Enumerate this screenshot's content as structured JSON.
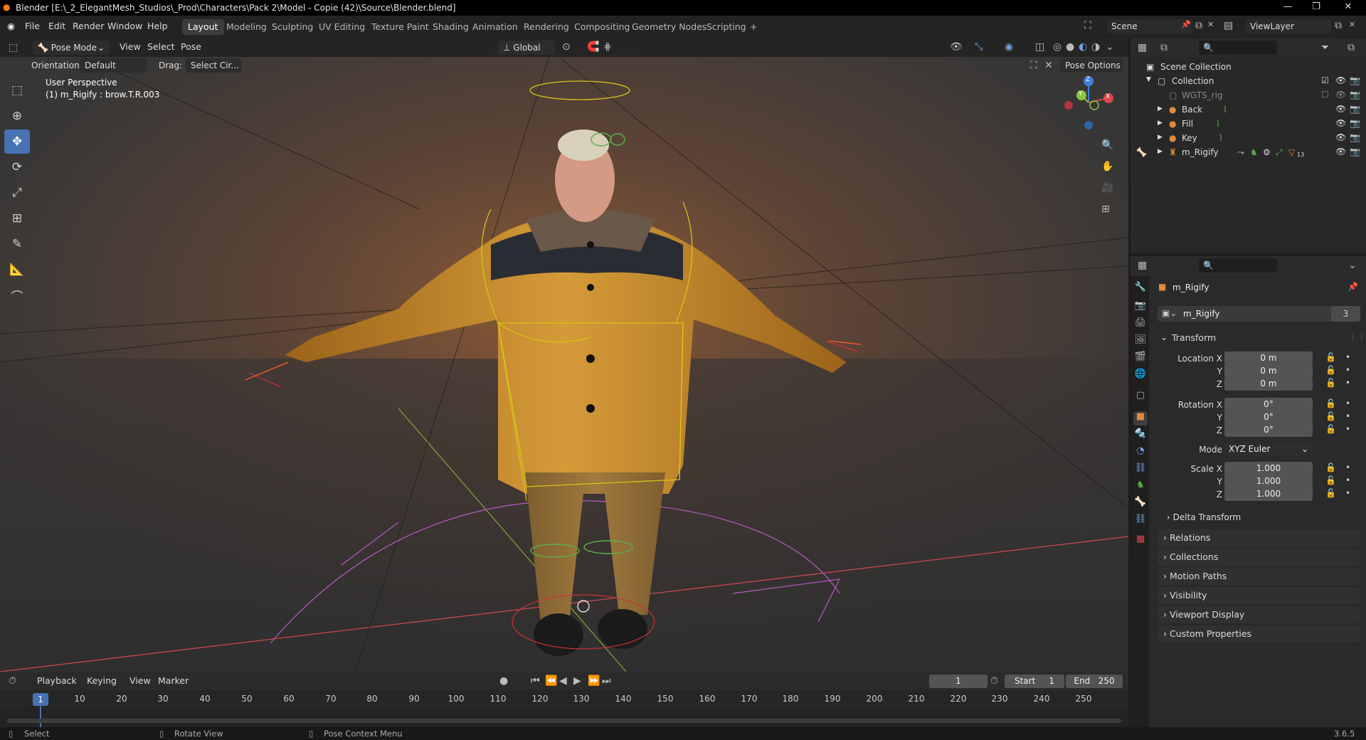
{
  "window": {
    "title": "Blender [E:\\_2_ElegantMesh_Studios\\_Prod\\Characters\\Pack 2\\Model - Copie (42)\\Source\\Blender.blend]"
  },
  "menu": {
    "file": "File",
    "edit": "Edit",
    "render": "Render",
    "window": "Window",
    "help": "Help"
  },
  "workspaces": [
    "Layout",
    "Modeling",
    "Sculpting",
    "UV Editing",
    "Texture Paint",
    "Shading",
    "Animation",
    "Rendering",
    "Compositing",
    "Geometry Nodes",
    "Scripting"
  ],
  "active_workspace": "Layout",
  "scene": {
    "name": "Scene",
    "view_layer": "ViewLayer"
  },
  "viewport_header": {
    "mode": "Pose Mode",
    "view": "View",
    "select": "Select",
    "pose": "Pose",
    "transform_orientation": "Global"
  },
  "tool_settings": {
    "orientation_label": "Orientation:",
    "orientation_value": "Default",
    "drag_label": "Drag:",
    "drag_value": "Select Cir...",
    "pose_options": "Pose Options"
  },
  "viewport_overlay": {
    "perspective": "User Perspective",
    "object_info": "(1) m_Rigify : brow.T.R.003"
  },
  "gizmo": {
    "z": "Z",
    "y": "Y",
    "x": "X"
  },
  "outliner": {
    "root": "Scene Collection",
    "collection": "Collection",
    "items": [
      {
        "name": "WGTS_rig"
      },
      {
        "name": "Back"
      },
      {
        "name": "Fill"
      },
      {
        "name": "Key"
      },
      {
        "name": "m_Rigify"
      }
    ],
    "badge_count": "13"
  },
  "properties": {
    "object_name": "m_Rigify",
    "data_name": "m_Rigify",
    "data_users": "3",
    "transform_header": "Transform",
    "location_x_label": "Location X",
    "location_x": "0 m",
    "location_y_label": "Y",
    "location_y": "0 m",
    "location_z_label": "Z",
    "location_z": "0 m",
    "rotation_x_label": "Rotation X",
    "rotation_x": "0°",
    "rotation_y_label": "Y",
    "rotation_y": "0°",
    "rotation_z_label": "Z",
    "rotation_z": "0°",
    "mode_label": "Mode",
    "mode_value": "XYZ Euler",
    "scale_x_label": "Scale X",
    "scale_x": "1.000",
    "scale_y_label": "Y",
    "scale_y": "1.000",
    "scale_z_label": "Z",
    "scale_z": "1.000",
    "delta_transform": "Delta Transform",
    "sections": [
      "Relations",
      "Collections",
      "Motion Paths",
      "Visibility",
      "Viewport Display",
      "Custom Properties"
    ]
  },
  "timeline": {
    "playback": "Playback",
    "keying": "Keying",
    "view": "View",
    "marker": "Marker",
    "current_frame": "1",
    "start_label": "Start",
    "start": "1",
    "end_label": "End",
    "end": "250",
    "ruler": [
      "10",
      "20",
      "30",
      "40",
      "50",
      "60",
      "70",
      "80",
      "90",
      "100",
      "110",
      "120",
      "130",
      "140",
      "150",
      "160",
      "170",
      "180",
      "190",
      "200",
      "210",
      "220",
      "230",
      "240",
      "250"
    ],
    "playhead": "1"
  },
  "statusbar": {
    "select": "Select",
    "rotate": "Rotate View",
    "context": "Pose Context Menu",
    "version": "3.6.5"
  },
  "colors": {
    "accent": "#4772b3",
    "jacket": "#c98a2a",
    "bone_yellow": "#d8c21a",
    "axis_red": "#d9474f",
    "axis_green": "#8cc63f",
    "axis_blue": "#3d82d4"
  }
}
